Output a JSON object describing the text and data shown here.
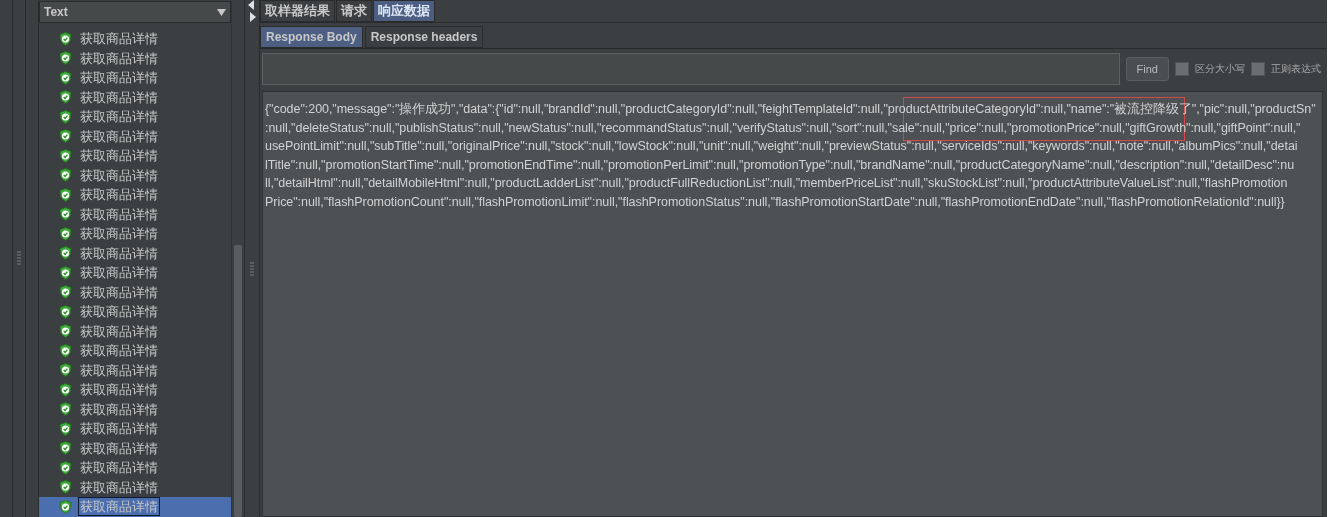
{
  "tree": {
    "filter": {
      "value": "Text"
    },
    "items": [
      {
        "label": "获取商品详情",
        "selected": false
      },
      {
        "label": "获取商品详情",
        "selected": false
      },
      {
        "label": "获取商品详情",
        "selected": false
      },
      {
        "label": "获取商品详情",
        "selected": false
      },
      {
        "label": "获取商品详情",
        "selected": false
      },
      {
        "label": "获取商品详情",
        "selected": false
      },
      {
        "label": "获取商品详情",
        "selected": false
      },
      {
        "label": "获取商品详情",
        "selected": false
      },
      {
        "label": "获取商品详情",
        "selected": false
      },
      {
        "label": "获取商品详情",
        "selected": false
      },
      {
        "label": "获取商品详情",
        "selected": false
      },
      {
        "label": "获取商品详情",
        "selected": false
      },
      {
        "label": "获取商品详情",
        "selected": false
      },
      {
        "label": "获取商品详情",
        "selected": false
      },
      {
        "label": "获取商品详情",
        "selected": false
      },
      {
        "label": "获取商品详情",
        "selected": false
      },
      {
        "label": "获取商品详情",
        "selected": false
      },
      {
        "label": "获取商品详情",
        "selected": false
      },
      {
        "label": "获取商品详情",
        "selected": false
      },
      {
        "label": "获取商品详情",
        "selected": false
      },
      {
        "label": "获取商品详情",
        "selected": false
      },
      {
        "label": "获取商品详情",
        "selected": false
      },
      {
        "label": "获取商品详情",
        "selected": false
      },
      {
        "label": "获取商品详情",
        "selected": false
      },
      {
        "label": "获取商品详情",
        "selected": true
      }
    ]
  },
  "tabs": [
    {
      "label": "取样器结果",
      "selected": false
    },
    {
      "label": "请求",
      "selected": false
    },
    {
      "label": "响应数据",
      "selected": true
    }
  ],
  "subtabs": [
    {
      "label": "Response Body",
      "selected": true
    },
    {
      "label": "Response headers",
      "selected": false
    }
  ],
  "search": {
    "button": "Find",
    "options": [
      {
        "label": "区分大小写",
        "checked": false
      },
      {
        "label": "正则表达式",
        "checked": false
      }
    ]
  },
  "body_lines": [
    "{\"code\":200,\"message\":\"操作成功\",\"data\":{\"id\":null,\"brandId\":null,\"productCategoryId\":null,\"feightTemplateId\":null,\"productAttributeCategoryId\":null,\"name\":\"被流控降级了\",\"pic\":null,\"productSn\"",
    ":null,\"deleteStatus\":null,\"publishStatus\":null,\"newStatus\":null,\"recommandStatus\":null,\"verifyStatus\":null,\"sort\":null,\"sale\":null,\"price\":null,\"promotionPrice\":null,\"giftGrowth\":null,\"giftPoint\":null,\"",
    "usePointLimit\":null,\"subTitle\":null,\"originalPrice\":null,\"stock\":null,\"lowStock\":null,\"unit\":null,\"weight\":null,\"previewStatus\":null,\"serviceIds\":null,\"keywords\":null,\"note\":null,\"albumPics\":null,\"detai",
    "lTitle\":null,\"promotionStartTime\":null,\"promotionEndTime\":null,\"promotionPerLimit\":null,\"promotionType\":null,\"brandName\":null,\"productCategoryName\":null,\"description\":null,\"detailDesc\":nu",
    "ll,\"detailHtml\":null,\"detailMobileHtml\":null,\"productLadderList\":null,\"productFullReductionList\":null,\"memberPriceList\":null,\"skuStockList\":null,\"productAttributeValueList\":null,\"flashPromotion",
    "Price\":null,\"flashPromotionCount\":null,\"flashPromotionLimit\":null,\"flashPromotionStatus\":null,\"flashPromotionStartDate\":null,\"flashPromotionEndDate\":null,\"flashPromotionRelationId\":null}}"
  ]
}
